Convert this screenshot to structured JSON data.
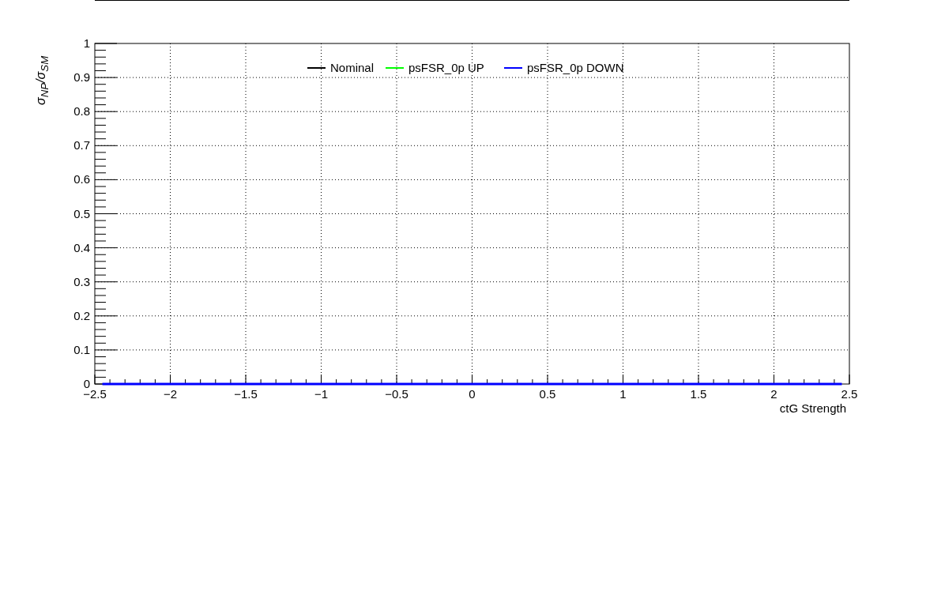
{
  "chart_data": {
    "type": "line",
    "legend": true,
    "xlabel": "ctG Strength",
    "ylabel": "σ$_{NP}$/σ$_{SM}$",
    "x": [
      -2.45,
      2.45
    ],
    "xlim": [
      -2.5,
      2.5
    ],
    "ylim": [
      0,
      1
    ],
    "xticks": [
      {
        "value": -2.5,
        "label": "−2.5"
      },
      {
        "value": -2,
        "label": "−2"
      },
      {
        "value": -1.5,
        "label": "−1.5"
      },
      {
        "value": -1,
        "label": "−1"
      },
      {
        "value": -0.5,
        "label": "−0.5"
      },
      {
        "value": 0,
        "label": "0"
      },
      {
        "value": 0.5,
        "label": "0.5"
      },
      {
        "value": 1,
        "label": "1"
      },
      {
        "value": 1.5,
        "label": "1.5"
      },
      {
        "value": 2,
        "label": "2"
      },
      {
        "value": 2.5,
        "label": "2.5"
      }
    ],
    "yticks": [
      {
        "value": 0,
        "label": "0"
      },
      {
        "value": 0.1,
        "label": "0.1"
      },
      {
        "value": 0.2,
        "label": "0.2"
      },
      {
        "value": 0.3,
        "label": "0.3"
      },
      {
        "value": 0.4,
        "label": "0.4"
      },
      {
        "value": 0.5,
        "label": "0.5"
      },
      {
        "value": 0.6,
        "label": "0.6"
      },
      {
        "value": 0.7,
        "label": "0.7"
      },
      {
        "value": 0.8,
        "label": "0.8"
      },
      {
        "value": 0.9,
        "label": "0.9"
      },
      {
        "value": 1,
        "label": "1"
      }
    ],
    "series": [
      {
        "name": "Nominal",
        "color": "#000000",
        "values": [
          null,
          null
        ]
      },
      {
        "name": "psFSR_0p UP",
        "color": "#00ff00",
        "values": [
          null,
          null
        ]
      },
      {
        "name": "psFSR_0p DOWN",
        "color": "#0000ff",
        "values": [
          0,
          0
        ]
      }
    ]
  }
}
